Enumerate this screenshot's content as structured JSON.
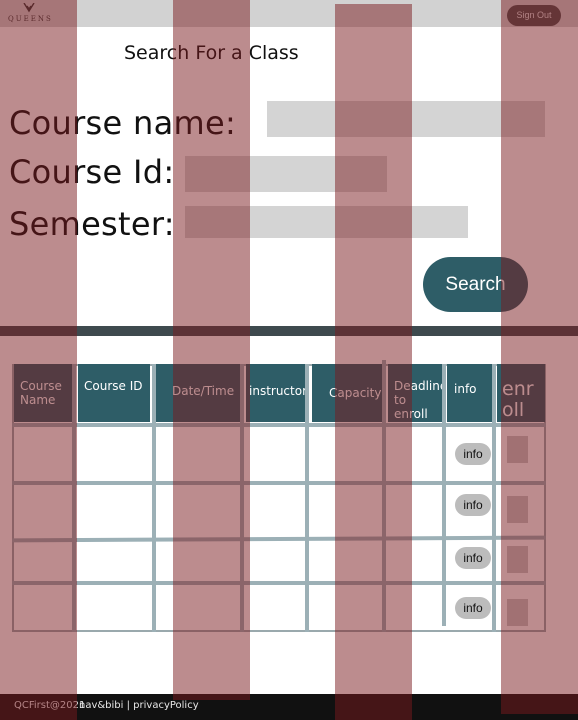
{
  "header": {
    "logo_text": "QUEENS",
    "signout_label": "Sign Out"
  },
  "search": {
    "title": "Search For a Class",
    "course_name_label": "Course name:",
    "course_id_label": "Course Id:",
    "semester_label": "Semester:",
    "course_name_value": "",
    "course_id_value": "",
    "semester_value": "",
    "button_label": "Search"
  },
  "table": {
    "headers": {
      "course_name": "Course Name",
      "course_id": "Course ID",
      "date_time": "Date/Time",
      "instructor": "instructor",
      "capacity": "Capacity",
      "deadline": "Deadline to enroll",
      "info": "info",
      "enroll": "enroll"
    },
    "rows": [
      {
        "info_label": "info"
      },
      {
        "info_label": "info"
      },
      {
        "info_label": "info"
      },
      {
        "info_label": "info"
      }
    ]
  },
  "footer": {
    "copyright": "QCFirst@2021",
    "links": "nav&bibi | privacyPolicy"
  },
  "colors": {
    "accent": "#2e5d67",
    "overlay": "#7a1a1e",
    "footer_bg": "#111111"
  }
}
